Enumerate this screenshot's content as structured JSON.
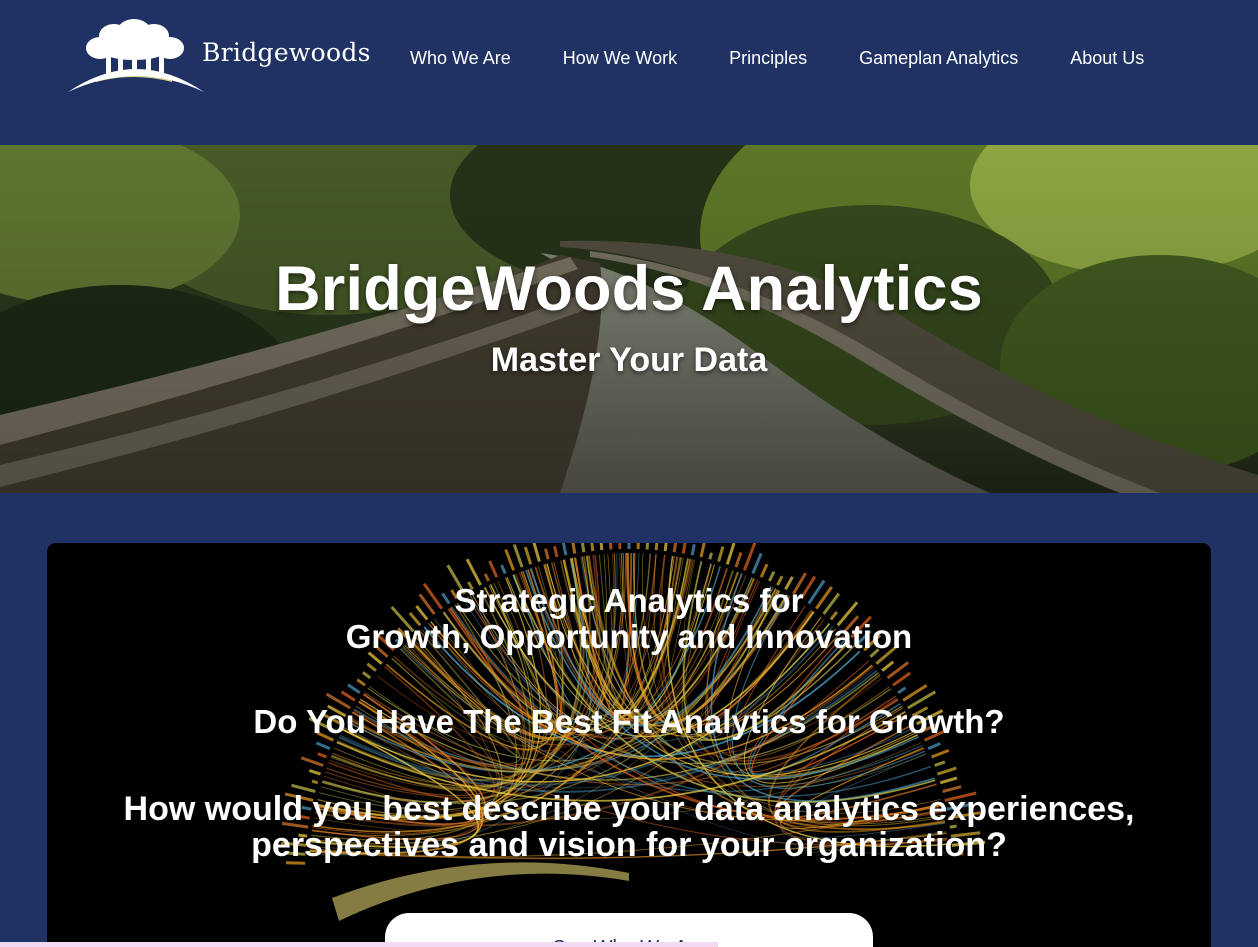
{
  "brand": {
    "name": "Bridgewoods",
    "logo_icon": "tree-bridge-logo-icon"
  },
  "nav": {
    "items": [
      {
        "label": "Who We Are"
      },
      {
        "label": "How We Work"
      },
      {
        "label": "Principles"
      },
      {
        "label": "Gameplan Analytics"
      },
      {
        "label": "About Us"
      }
    ]
  },
  "hero": {
    "title": "BridgeWoods Analytics",
    "subtitle": "Master Your Data",
    "background_icon": "forest-boardwalk-photo"
  },
  "feature": {
    "line1": "Strategic Analytics for",
    "line2": "Growth, Opportunity and Innovation",
    "line3": "Do You Have The Best Fit Analytics for Growth?",
    "line4": "How would you best describe your data analytics experiences,",
    "line5": "perspectives and vision for your organization?",
    "cta_label": "See Who We Are",
    "background_icon": "radial-data-visualization-image"
  },
  "colors": {
    "header_bg": "#1f3263",
    "text": "#ffffff",
    "card_bg": "#000000",
    "cta_bg": "#ffffff",
    "cta_text": "#1f3263",
    "logo_accent": "#d9cf8f"
  }
}
